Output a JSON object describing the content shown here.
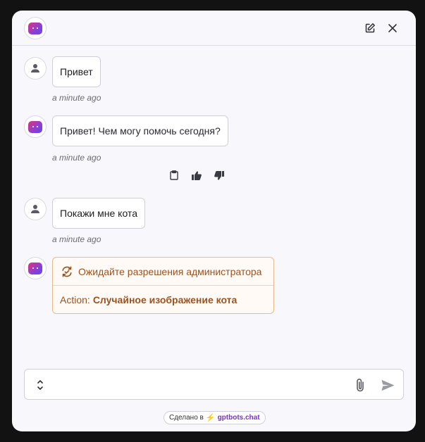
{
  "header": {
    "edit_icon": "edit-icon",
    "close_icon": "close-icon"
  },
  "messages": [
    {
      "role": "user",
      "text": "Привет",
      "time": "a minute ago"
    },
    {
      "role": "bot",
      "text": "Привет! Чем могу помочь сегодня?",
      "time": "a minute ago",
      "actions": [
        "clipboard-icon",
        "thumbs-up-icon",
        "thumbs-down-icon"
      ]
    },
    {
      "role": "user",
      "text": "Покажи мне кота",
      "time": "a minute ago"
    },
    {
      "role": "bot",
      "approval": {
        "status": "Ожидайте разрешения администратора",
        "action_label": "Action:",
        "action_name": "Случайное изображение кота"
      }
    }
  ],
  "composer": {
    "value": "",
    "placeholder": ""
  },
  "footer": {
    "made_with": "Сделано в",
    "bolt": "⚡",
    "brand": "gptbots.chat"
  },
  "colors": {
    "accent_gradient_start": "#e0327c",
    "accent_gradient_end": "#5b49e8",
    "approval_text": "#9a5320",
    "approval_border": "#e8b98c",
    "brand": "#7b2fd0"
  }
}
